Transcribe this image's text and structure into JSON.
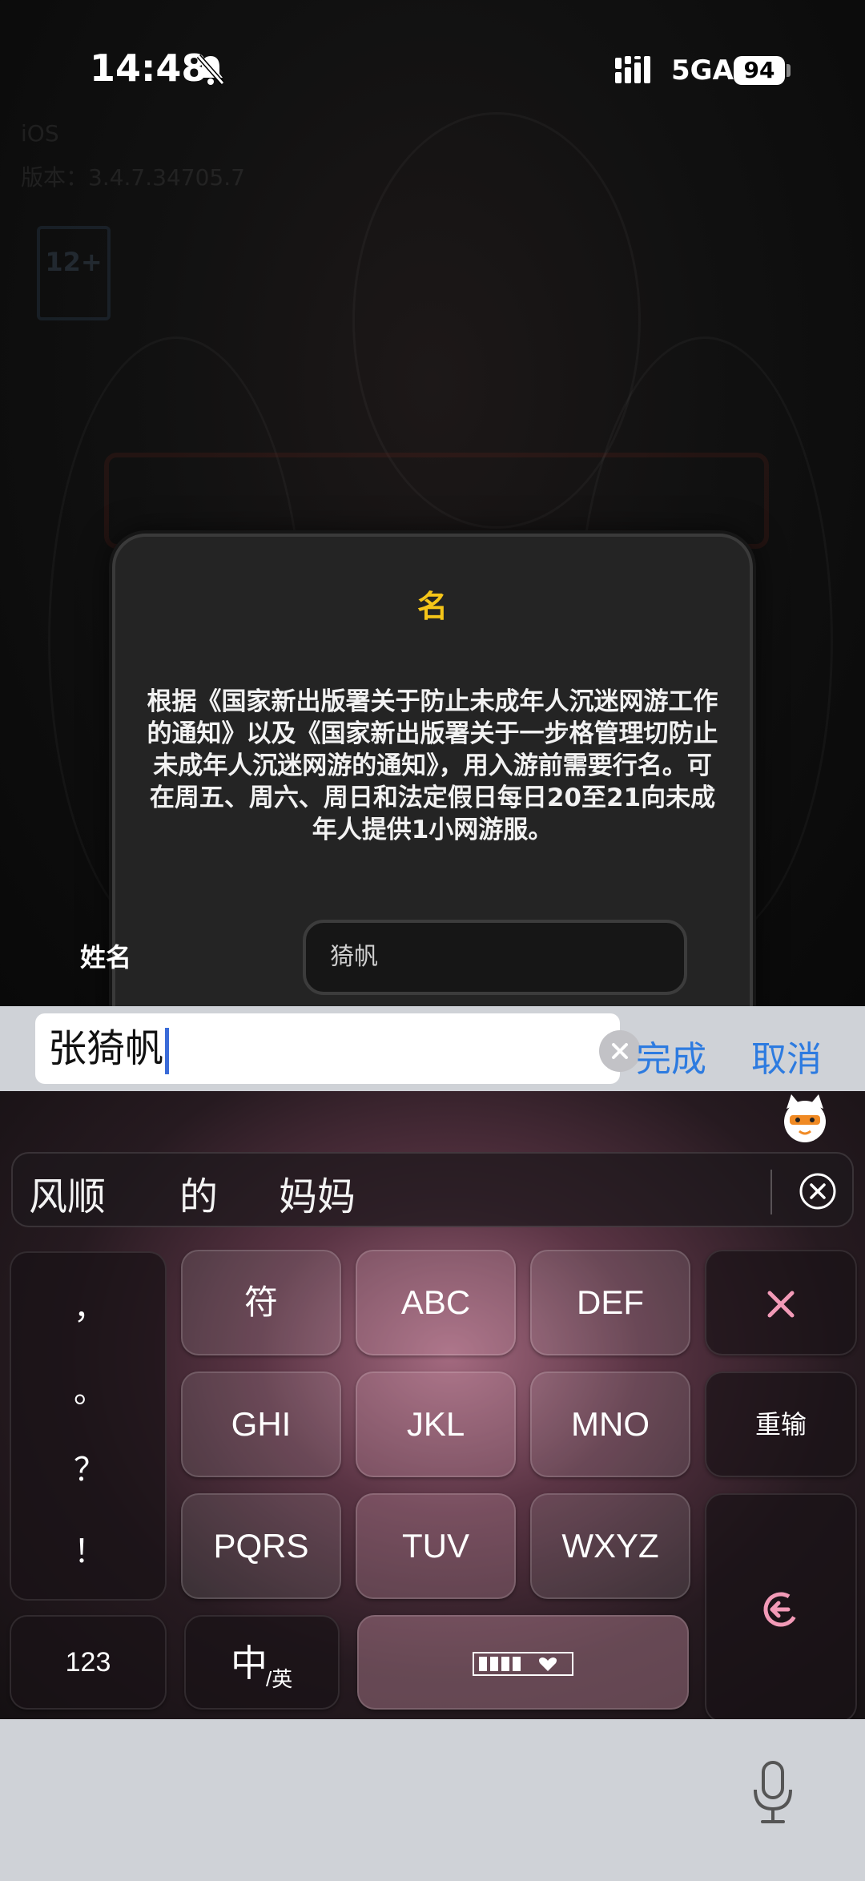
{
  "status_bar": {
    "time": "14:48",
    "network": "5GA",
    "battery": "94"
  },
  "background": {
    "platform": "iOS",
    "version": "版本：3.4.7.34705.7",
    "age_rating": "12+"
  },
  "dialog": {
    "title": "名",
    "body": "根据《国家新出版署关于防止未成年人沉迷网游工作的通知》以及《国家新出版署关于一步格管理切防止未成年人沉迷网游的通知》，用入游前需要行名。可在周五、周六、周日和法定假日每日20至21向未成年人提供1小网游服。",
    "name_label": "姓名",
    "name_value": "猗帆"
  },
  "input_bar": {
    "value": "张猗帆",
    "done": "完成",
    "cancel": "取消"
  },
  "keyboard": {
    "candidates": [
      "风顺",
      "的",
      "妈妈"
    ],
    "punctuation": [
      "，",
      "。",
      "？",
      "！"
    ],
    "rows": [
      [
        "符",
        "ABC",
        "DEF"
      ],
      [
        "GHI",
        "JKL",
        "MNO"
      ],
      [
        "PQRS",
        "TUV",
        "WXYZ"
      ]
    ],
    "retype": "重输",
    "num_key": "123",
    "lang_key_main": "中",
    "lang_key_sub": "/英",
    "delete_color": "#f29ab7",
    "accent": "#f29ab7"
  }
}
